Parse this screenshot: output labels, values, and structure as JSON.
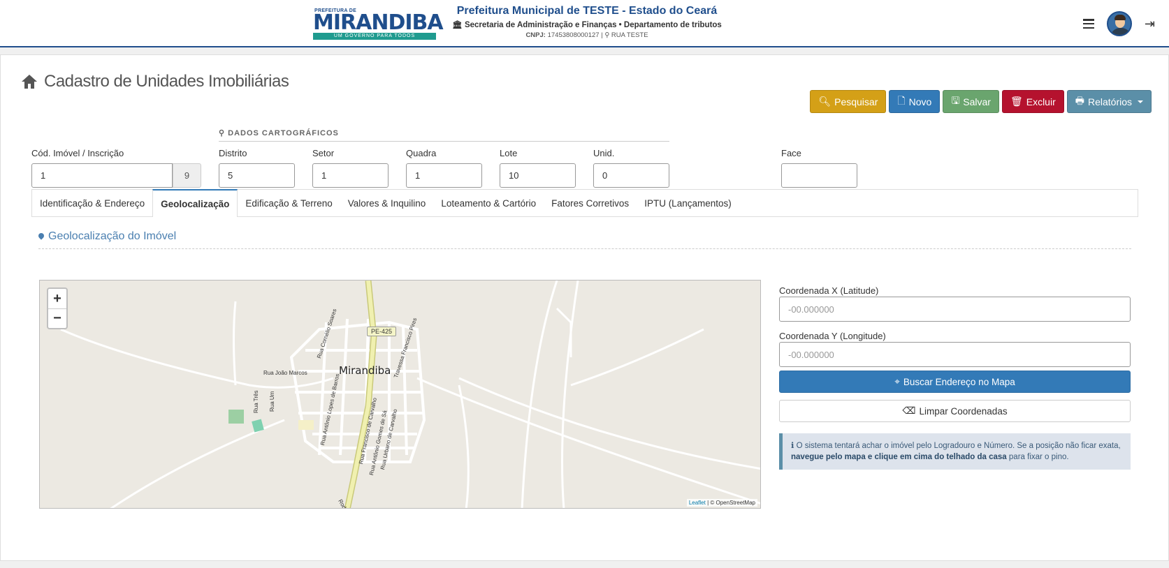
{
  "header": {
    "logo_top": "PREFEITURA DE",
    "logo_main": "MIRANDIBA",
    "logo_tagline": "UM GOVERNO PARA TODOS",
    "title": "Prefeitura Municipal de TESTE - Estado do Ceará",
    "subtitle": "Secretaria de Administração e Finanças • Departamento de tributos",
    "cnpj_label": "CNPJ:",
    "cnpj_value": "17453808000127",
    "address": "RUA TESTE"
  },
  "page": {
    "title": "Cadastro de Unidades Imobiliárias"
  },
  "toolbar": {
    "search_label": "Pesquisar",
    "new_label": "Novo",
    "save_label": "Salvar",
    "delete_label": "Excluir",
    "reports_label": "Relatórios"
  },
  "form": {
    "carto_heading": "DADOS CARTOGRÁFICOS",
    "cod_label": "Cód. Imóvel / Inscrição",
    "cod_value": "1",
    "cod_addon": "9",
    "distrito_label": "Distrito",
    "distrito_value": "5",
    "setor_label": "Setor",
    "setor_value": "1",
    "quadra_label": "Quadra",
    "quadra_value": "1",
    "lote_label": "Lote",
    "lote_value": "10",
    "unid_label": "Unid.",
    "unid_value": "0",
    "face_label": "Face",
    "face_value": ""
  },
  "tabs": [
    {
      "label": "Identificação & Endereço"
    },
    {
      "label": "Geolocalização"
    },
    {
      "label": "Edificação & Terreno"
    },
    {
      "label": "Valores & Inquilino"
    },
    {
      "label": "Loteamento & Cartório"
    },
    {
      "label": "Fatores Corretivos"
    },
    {
      "label": "IPTU (Lançamentos)"
    }
  ],
  "geo": {
    "section_title": "Geolocalização do Imóvel",
    "lat_label": "Coordenada X (Latitude)",
    "lat_placeholder": "-00.000000",
    "lng_label": "Coordenada Y (Longitude)",
    "lng_placeholder": "-00.000000",
    "find_button": "Buscar Endereço no Mapa",
    "clear_button": "Limpar Coordenadas",
    "note_part1": "O sistema tentará achar o imóvel pelo Logradouro e Número. Se a posição não ficar exata,",
    "note_bold": "navegue pelo mapa e clique em cima do telhado da casa",
    "note_part2": "para fixar o pino."
  },
  "map": {
    "town": "Mirandiba",
    "highway": "PE-425",
    "zoom_in": "+",
    "zoom_out": "−",
    "attribution_link": "Leaflet",
    "attribution_rest": "| © OpenStreetMap",
    "streets": {
      "s1": "Rua João Marcos",
      "s2": "Rua Cornélio Soares",
      "s3": "Travessa Francisco Pires",
      "s4": "Rua Três",
      "s5": "Rua Um",
      "s6": "Rua Antônio Lopes de Barros",
      "s7": "Rua Francisco de Carvalho",
      "s8": "Rua Antônio Gomes de Sá",
      "s9": "Rua Urbano de Carvalho",
      "s10": "Rodo"
    }
  },
  "colors": {
    "primary": "#337ab7",
    "warning": "#d4a017",
    "success": "#6aa56e",
    "danger": "#b5122e",
    "info": "#5b8fa8"
  }
}
